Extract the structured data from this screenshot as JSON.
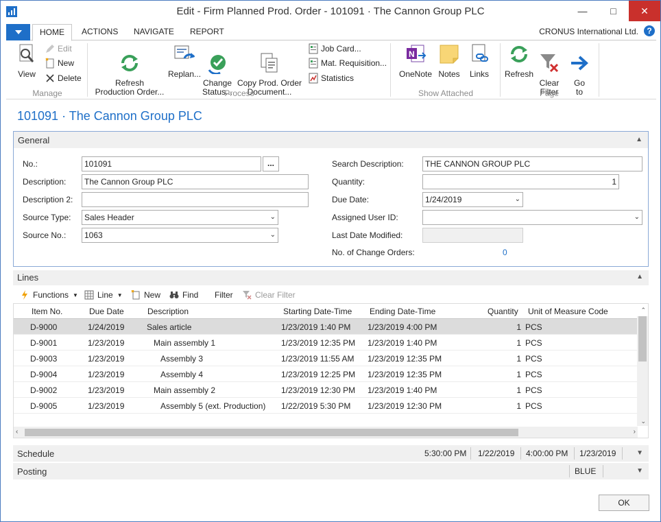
{
  "window": {
    "title": "Edit - Firm Planned Prod. Order - 101091 · The Cannon Group PLC"
  },
  "ribbon_tabs": [
    "HOME",
    "ACTIONS",
    "NAVIGATE",
    "REPORT"
  ],
  "company": "CRONUS International Ltd.",
  "help": "?",
  "ribbon": {
    "manage": {
      "label": "Manage",
      "view": "View",
      "edit": "Edit",
      "new": "New",
      "delete": "Delete"
    },
    "process": {
      "label": "Process",
      "refresh_production_order": "Refresh\nProduction Order...",
      "replan": "Replan...",
      "change_status": "Change\nStatus...",
      "copy_prod_order_document": "Copy Prod. Order\nDocument...",
      "job_card": "Job Card...",
      "mat_requisition": "Mat. Requisition...",
      "statistics": "Statistics"
    },
    "show_attached": {
      "label": "Show Attached",
      "onenote": "OneNote",
      "notes": "Notes",
      "links": "Links"
    },
    "page": {
      "label": "Page",
      "refresh": "Refresh",
      "clear_filter": "Clear\nFilter",
      "go_to": "Go\nto"
    }
  },
  "page_title": "101091 · The Cannon Group PLC",
  "general": {
    "header": "General",
    "no_label": "No.:",
    "no_value": "101091",
    "assist": "...",
    "description_label": "Description:",
    "description_value": "The Cannon Group PLC",
    "description2_label": "Description 2:",
    "description2_value": "",
    "source_type_label": "Source Type:",
    "source_type_value": "Sales Header",
    "source_no_label": "Source No.:",
    "source_no_value": "1063",
    "search_description_label": "Search Description:",
    "search_description_value": "THE CANNON GROUP PLC",
    "quantity_label": "Quantity:",
    "quantity_value": "1",
    "due_date_label": "Due Date:",
    "due_date_value": "1/24/2019",
    "assigned_user_label": "Assigned User ID:",
    "assigned_user_value": "",
    "last_date_modified_label": "Last Date Modified:",
    "last_date_modified_value": "",
    "change_orders_label": "No. of Change Orders:",
    "change_orders_value": "0"
  },
  "lines": {
    "header": "Lines",
    "toolbar": {
      "functions": "Functions",
      "line": "Line",
      "new": "New",
      "find": "Find",
      "filter": "Filter",
      "clear_filter": "Clear Filter"
    },
    "columns": [
      "Item No.",
      "Due Date",
      "Description",
      "Starting Date-Time",
      "Ending Date-Time",
      "Quantity",
      "Unit of Measure Code"
    ],
    "rows": [
      {
        "item": "D-9000",
        "due": "1/24/2019",
        "desc": "Sales article",
        "start": "1/23/2019 1:40 PM",
        "end": "1/23/2019 4:00 PM",
        "qty": "1",
        "uom": "PCS",
        "indent": 0
      },
      {
        "item": "D-9001",
        "due": "1/23/2019",
        "desc": "Main assembly 1",
        "start": "1/23/2019 12:35 PM",
        "end": "1/23/2019 1:40 PM",
        "qty": "1",
        "uom": "PCS",
        "indent": 1
      },
      {
        "item": "D-9003",
        "due": "1/23/2019",
        "desc": "Assembly 3",
        "start": "1/23/2019 11:55 AM",
        "end": "1/23/2019 12:35 PM",
        "qty": "1",
        "uom": "PCS",
        "indent": 2
      },
      {
        "item": "D-9004",
        "due": "1/23/2019",
        "desc": "Assembly 4",
        "start": "1/23/2019 12:25 PM",
        "end": "1/23/2019 12:35 PM",
        "qty": "1",
        "uom": "PCS",
        "indent": 2
      },
      {
        "item": "D-9002",
        "due": "1/23/2019",
        "desc": "Main assembly 2",
        "start": "1/23/2019 12:30 PM",
        "end": "1/23/2019 1:40 PM",
        "qty": "1",
        "uom": "PCS",
        "indent": 1
      },
      {
        "item": "D-9005",
        "due": "1/23/2019",
        "desc": "Assembly 5 (ext. Production)",
        "start": "1/22/2019 5:30 PM",
        "end": "1/23/2019 12:30 PM",
        "qty": "1",
        "uom": "PCS",
        "indent": 2
      }
    ]
  },
  "schedule": {
    "header": "Schedule",
    "starting_time": "5:30:00 PM",
    "starting_date": "1/22/2019",
    "ending_time": "4:00:00 PM",
    "ending_date": "1/23/2019"
  },
  "posting": {
    "header": "Posting",
    "location": "BLUE"
  },
  "ok_label": "OK",
  "colors": {
    "accent": "#1e6fc8",
    "selected_row": "#dcdcdc",
    "close_button": "#c9302c"
  }
}
